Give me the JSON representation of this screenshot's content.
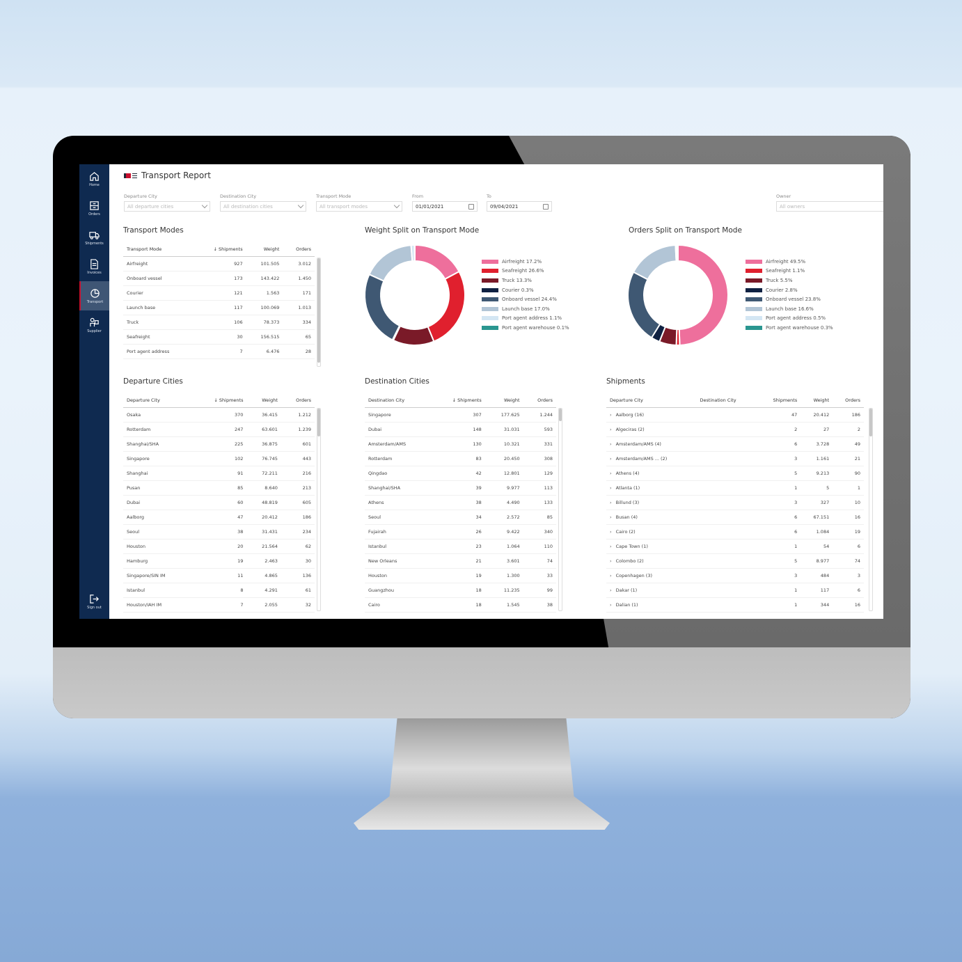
{
  "app": {
    "title": "Transport Report"
  },
  "sidebar": {
    "items": [
      {
        "label": "Home",
        "icon": "home-icon"
      },
      {
        "label": "Orders",
        "icon": "orders-icon"
      },
      {
        "label": "Shipments",
        "icon": "truck-icon"
      },
      {
        "label": "Invoices",
        "icon": "invoice-icon"
      },
      {
        "label": "Transport",
        "icon": "pie-chart-icon",
        "active": true
      },
      {
        "label": "Supplier",
        "icon": "supplier-icon"
      }
    ],
    "signout": "Sign out"
  },
  "filters": {
    "departure": {
      "label": "Departure City",
      "placeholder": "All departure cities"
    },
    "destination": {
      "label": "Destination City",
      "placeholder": "All destination cities"
    },
    "mode": {
      "label": "Transport Mode",
      "placeholder": "All transport modes"
    },
    "from": {
      "label": "From",
      "value": "01/01/2021"
    },
    "to": {
      "label": "To",
      "value": "09/04/2021"
    },
    "owner": {
      "label": "Owner",
      "placeholder": "All owners"
    }
  },
  "transport_modes": {
    "title": "Transport Modes",
    "columns": [
      "Transport Mode",
      "Shipments",
      "Weight",
      "Orders"
    ],
    "rows": [
      [
        "Airfreight",
        "927",
        "101.505",
        "3.012"
      ],
      [
        "Onboard vessel",
        "173",
        "143.422",
        "1.450"
      ],
      [
        "Courier",
        "121",
        "1.563",
        "171"
      ],
      [
        "Launch base",
        "117",
        "100.069",
        "1.013"
      ],
      [
        "Truck",
        "106",
        "78.373",
        "334"
      ],
      [
        "Seafreight",
        "30",
        "156.515",
        "65"
      ],
      [
        "Port agent address",
        "7",
        "6.476",
        "28"
      ]
    ]
  },
  "colors": {
    "Airfreight": "#ee6f9c",
    "Seafreight": "#e0202e",
    "Truck": "#7a1a28",
    "Courier": "#0f2142",
    "Onboard vessel": "#3f5873",
    "Launch base": "#b2c5d6",
    "Port agent address": "#d3e6f3",
    "Port agent warehouse": "#2a9690"
  },
  "chart_data": [
    {
      "type": "pie",
      "title": "Weight Split on Transport Mode",
      "categories": [
        "Airfreight",
        "Seafreight",
        "Truck",
        "Courier",
        "Onboard vessel",
        "Launch base",
        "Port agent address",
        "Port agent warehouse"
      ],
      "values": [
        17.2,
        26.6,
        13.3,
        0.3,
        24.4,
        17.0,
        1.1,
        0.1
      ],
      "legend": [
        "Airfreight 17.2%",
        "Seafreight 26.6%",
        "Truck 13.3%",
        "Courier 0.3%",
        "Onboard vessel 24.4%",
        "Launch base 17.0%",
        "Port agent address 1.1%",
        "Port agent warehouse 0.1%"
      ],
      "legend_position": "right"
    },
    {
      "type": "pie",
      "title": "Orders Split on Transport Mode",
      "categories": [
        "Airfreight",
        "Seafreight",
        "Truck",
        "Courier",
        "Onboard vessel",
        "Launch base",
        "Port agent address",
        "Port agent warehouse"
      ],
      "values": [
        49.5,
        1.1,
        5.5,
        2.8,
        23.8,
        16.6,
        0.5,
        0.3
      ],
      "legend": [
        "Airfreight 49.5%",
        "Seafreight 1.1%",
        "Truck 5.5%",
        "Courier 2.8%",
        "Onboard vessel 23.8%",
        "Launch base 16.6%",
        "Port agent address 0.5%",
        "Port agent warehouse 0.3%"
      ],
      "legend_position": "right"
    }
  ],
  "departure_cities": {
    "title": "Departure Cities",
    "columns": [
      "Departure City",
      "Shipments",
      "Weight",
      "Orders"
    ],
    "rows": [
      [
        "Osaka",
        "370",
        "36.415",
        "1.212"
      ],
      [
        "Rotterdam",
        "247",
        "63.601",
        "1.239"
      ],
      [
        "Shanghai/SHA",
        "225",
        "36.875",
        "601"
      ],
      [
        "Singapore",
        "102",
        "76.745",
        "443"
      ],
      [
        "Shanghai",
        "91",
        "72.211",
        "216"
      ],
      [
        "Pusan",
        "85",
        "8.640",
        "213"
      ],
      [
        "Dubai",
        "60",
        "48.819",
        "605"
      ],
      [
        "Aalborg",
        "47",
        "20.412",
        "186"
      ],
      [
        "Seoul",
        "38",
        "31.431",
        "234"
      ],
      [
        "Houston",
        "20",
        "21.564",
        "62"
      ],
      [
        "Hamburg",
        "19",
        "2.463",
        "30"
      ],
      [
        "Singapore/SIN IM",
        "11",
        "4.865",
        "136"
      ],
      [
        "Istanbul",
        "8",
        "4.291",
        "61"
      ],
      [
        "Houston/IAH IM",
        "7",
        "2.055",
        "32"
      ]
    ]
  },
  "destination_cities": {
    "title": "Destination Cities",
    "columns": [
      "Destination City",
      "Shipments",
      "Weight",
      "Orders"
    ],
    "rows": [
      [
        "Singapore",
        "307",
        "177.625",
        "1.244"
      ],
      [
        "Dubai",
        "148",
        "31.031",
        "593"
      ],
      [
        "Amsterdam/AMS",
        "130",
        "10.321",
        "331"
      ],
      [
        "Rotterdam",
        "83",
        "20.450",
        "308"
      ],
      [
        "Qingdao",
        "42",
        "12.801",
        "129"
      ],
      [
        "Shanghai/SHA",
        "39",
        "9.977",
        "113"
      ],
      [
        "Athens",
        "38",
        "4.490",
        "133"
      ],
      [
        "Seoul",
        "34",
        "2.572",
        "85"
      ],
      [
        "Fujairah",
        "26",
        "9.422",
        "340"
      ],
      [
        "Istanbul",
        "23",
        "1.064",
        "110"
      ],
      [
        "New Orleans",
        "21",
        "3.601",
        "74"
      ],
      [
        "Houston",
        "19",
        "1.300",
        "33"
      ],
      [
        "Guangzhou",
        "18",
        "11.235",
        "99"
      ],
      [
        "Cairo",
        "18",
        "1.545",
        "38"
      ]
    ]
  },
  "shipments": {
    "title": "Shipments",
    "columns": [
      "Departure City",
      "Destination City",
      "Shipments",
      "Weight",
      "Orders"
    ],
    "rows": [
      [
        "Aalborg (16)",
        "",
        "47",
        "20.412",
        "186"
      ],
      [
        "Algeciras (2)",
        "",
        "2",
        "27",
        "2"
      ],
      [
        "Amsterdam/AMS (4)",
        "",
        "6",
        "3.728",
        "49"
      ],
      [
        "Amsterdam/AMS ... (2)",
        "",
        "3",
        "1.161",
        "21"
      ],
      [
        "Athens (4)",
        "",
        "5",
        "9.213",
        "90"
      ],
      [
        "Atlanta (1)",
        "",
        "1",
        "5",
        "1"
      ],
      [
        "Billund (3)",
        "",
        "3",
        "327",
        "10"
      ],
      [
        "Busan (4)",
        "",
        "6",
        "67.151",
        "16"
      ],
      [
        "Cairo (2)",
        "",
        "6",
        "1.084",
        "19"
      ],
      [
        "Cape Town (1)",
        "",
        "1",
        "54",
        "6"
      ],
      [
        "Colombo (2)",
        "",
        "5",
        "8.977",
        "74"
      ],
      [
        "Copenhagen (3)",
        "",
        "3",
        "484",
        "3"
      ],
      [
        "Dakar (1)",
        "",
        "1",
        "117",
        "6"
      ],
      [
        "Dalian (1)",
        "",
        "1",
        "344",
        "16"
      ]
    ]
  }
}
